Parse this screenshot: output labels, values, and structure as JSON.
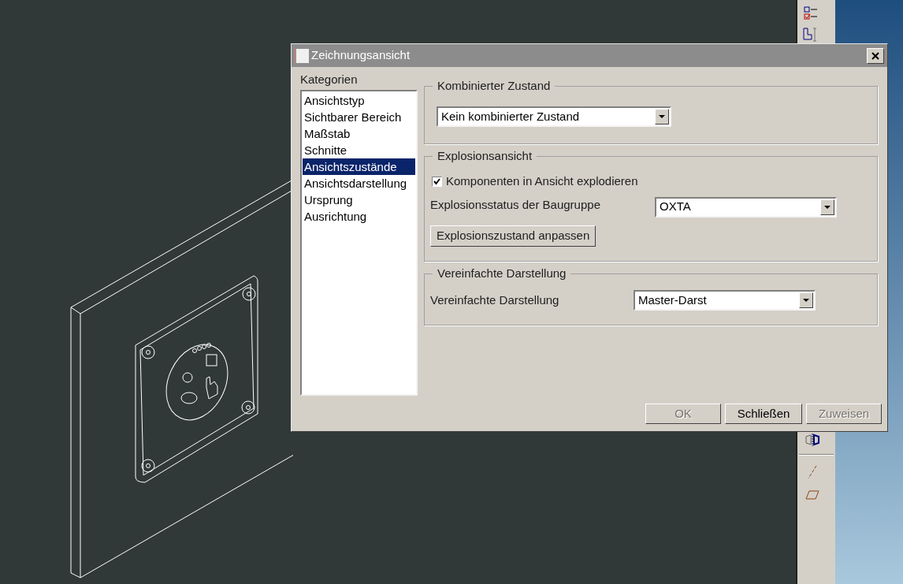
{
  "window": {
    "title": "Zeichnungsansicht"
  },
  "categories": {
    "label": "Kategorien",
    "items": [
      {
        "label": "Ansichtstyp",
        "selected": false
      },
      {
        "label": "Sichtbarer Bereich",
        "selected": false
      },
      {
        "label": "Maßstab",
        "selected": false
      },
      {
        "label": "Schnitte",
        "selected": false
      },
      {
        "label": "Ansichtszustände",
        "selected": true
      },
      {
        "label": "Ansichtsdarstellung",
        "selected": false
      },
      {
        "label": "Ursprung",
        "selected": false
      },
      {
        "label": "Ausrichtung",
        "selected": false
      }
    ]
  },
  "combined_state": {
    "title": "Kombinierter Zustand",
    "value": "Kein kombinierter Zustand"
  },
  "explosion": {
    "title": "Explosionsansicht",
    "checkbox": {
      "label": "Komponenten in Ansicht explodieren",
      "checked": true
    },
    "status_label": "Explosionsstatus der Baugruppe",
    "status_value": "OXTA",
    "button": "Explosionszustand anpassen"
  },
  "simplified": {
    "title": "Vereinfachte Darstellung",
    "label": "Vereinfachte Darstellung",
    "value": "Master-Darst"
  },
  "buttons": [
    {
      "label": "OK",
      "disabled": true
    },
    {
      "label": "Schließen",
      "disabled": false
    },
    {
      "label": "Zuweisen",
      "disabled": true
    }
  ]
}
